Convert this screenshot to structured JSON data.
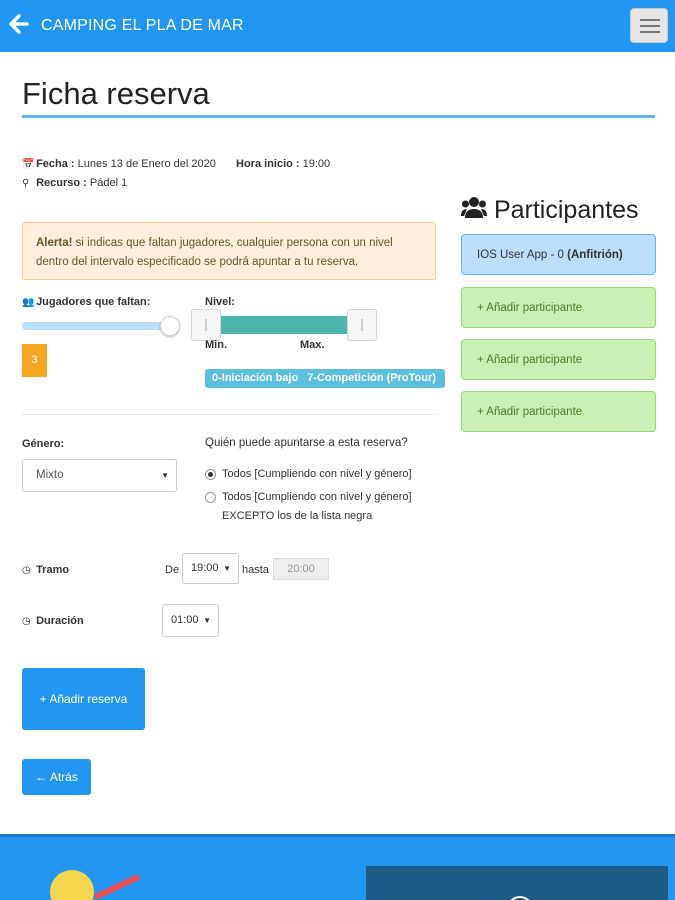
{
  "header": {
    "title": "CAMPING EL PLA DE MAR",
    "back_icon": "arrow-left-icon",
    "menu_icon": "hamburger-menu-icon",
    "bg_color": "#2196f3"
  },
  "page": {
    "title": "Ficha reserva"
  },
  "info": {
    "fecha_label": "Fecha :",
    "fecha_value": "Lunes 13 de Enero del 2020",
    "hora_label": "Hora inicio :",
    "hora_value": "19:00",
    "recurso_label": "Recurso :",
    "recurso_value": "Pádel 1"
  },
  "alert": {
    "strong": "Alerta!",
    "text": " si indicas que faltan jugadores, cualquier persona con un nivel dentro del intervalo especificado se podrá apuntar a tu reserva."
  },
  "players": {
    "label": "Jugadores que faltan:",
    "value": "3"
  },
  "level": {
    "label": "Nivel:",
    "min_label": "Min.",
    "max_label": "Max.",
    "min_value": "0-Iniciación bajo",
    "max_value": "7-Competición (ProTour)"
  },
  "gender": {
    "label": "Género:",
    "selected": "Mixto"
  },
  "who": {
    "question": "Quién puede apuntarse a esta reserva?",
    "option1": "Todos [Cumpliendo con nivel y género]",
    "option2_line1": "Todos [Cumpliendo con nivel y género]",
    "option2_line2": "EXCEPTO los de la lista negra"
  },
  "tramo": {
    "label": "Tramo",
    "de_label": "De",
    "from_value": "19:00",
    "hasta_label": "hasta",
    "to_value": "20:00"
  },
  "duracion": {
    "label": "Duración",
    "value": "01:00"
  },
  "buttons": {
    "add_reservation": "+ Añadir reserva",
    "back": "← Atrás"
  },
  "participants": {
    "title": "Participantes",
    "host_name": "IOS User App - 0",
    "host_role": "(Anfitrión)",
    "add_label": "+ Añadir participante",
    "icon": "users-icon"
  },
  "colors": {
    "primary": "#2196f3",
    "alert_bg": "#fcf0dc",
    "range_fill": "#4db6ac",
    "badge": "#5bc0de",
    "add_participant_bg": "#c8f0b4",
    "host_bg": "#bbdefb",
    "value_badge": "#f5a623"
  }
}
